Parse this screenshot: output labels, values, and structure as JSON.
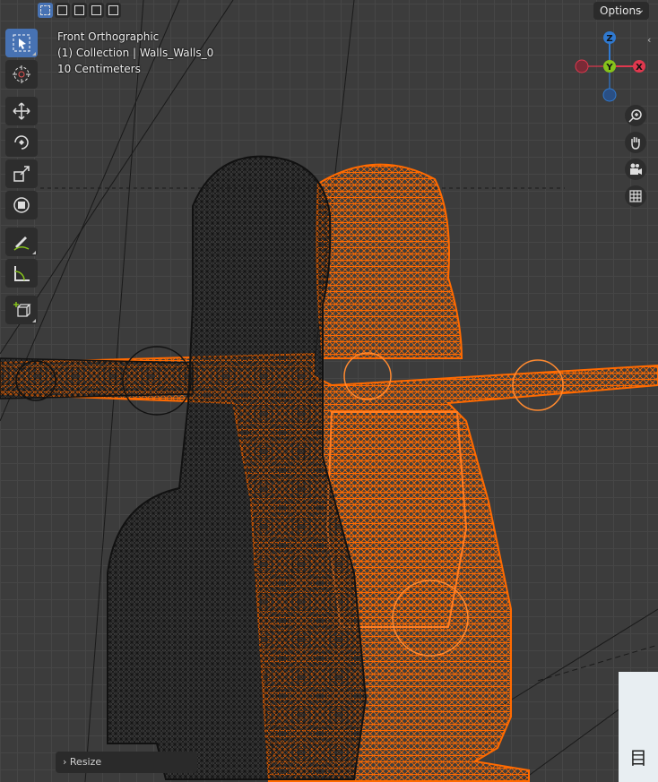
{
  "header": {
    "select_modes": [
      "mode-new",
      "mode-extend",
      "mode-subtract",
      "mode-difference",
      "mode-intersect"
    ],
    "options_label": "Options"
  },
  "viewport_info": {
    "view_name": "Front Orthographic",
    "collection": "(1) Collection | Walls_Walls_0",
    "scale": "10 Centimeters"
  },
  "toolbar": {
    "tools": [
      "select-box",
      "cursor",
      "move",
      "rotate",
      "scale",
      "transform",
      "annotate",
      "measure",
      "add-cube"
    ]
  },
  "gizmo": {
    "z": "Z",
    "y": "Y",
    "x": "X"
  },
  "colors": {
    "accent": "#4772b3",
    "wire_dark": "#101010",
    "wire_selected": "#ff6a00",
    "axis_x": "#e0384e",
    "axis_y": "#85c21b",
    "axis_z": "#2f79d0"
  },
  "navigation": [
    "zoom-icon",
    "hand-pan-icon",
    "camera-icon",
    "grid-icon"
  ],
  "resize_panel": {
    "label": "Resize"
  },
  "thumbnail": {
    "glyph": "目"
  }
}
